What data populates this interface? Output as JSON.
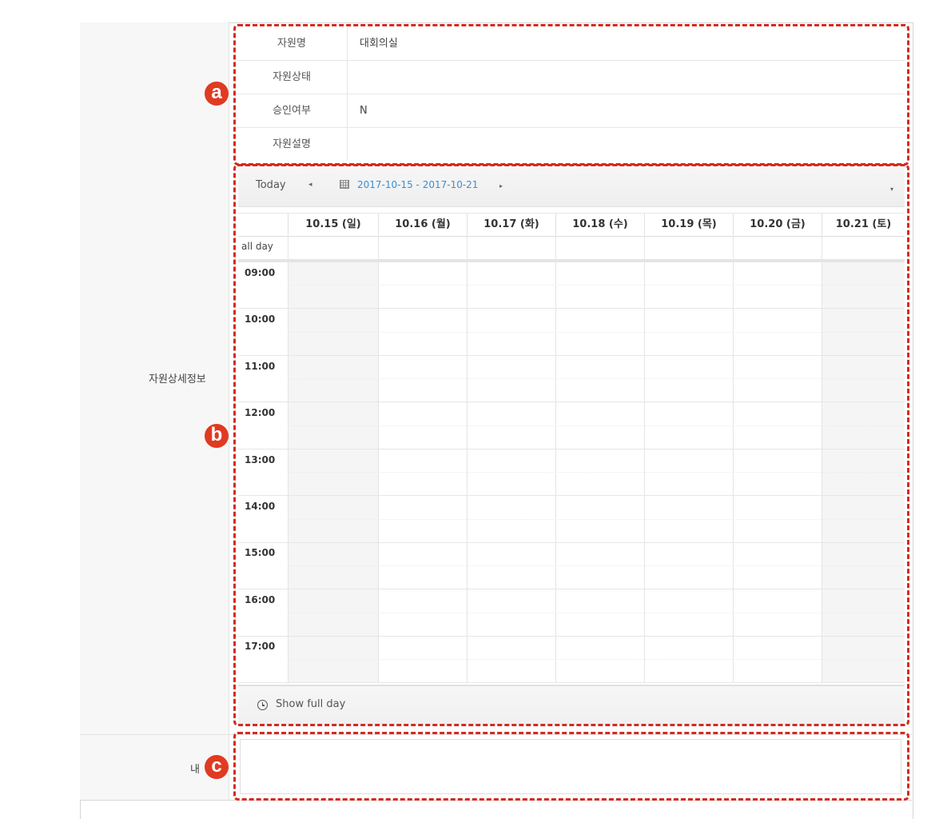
{
  "left_labels": {
    "detail": "자원상세정보",
    "content": "내"
  },
  "info": {
    "rows": [
      {
        "label": "자원명",
        "value": "대회의실"
      },
      {
        "label": "자원상태",
        "value": ""
      },
      {
        "label": "승인여부",
        "value": "N"
      },
      {
        "label": "자원설명",
        "value": ""
      }
    ]
  },
  "calendar": {
    "today_label": "Today",
    "prev_icon": "◂",
    "next_icon": "▸",
    "dropdown_icon": "▾",
    "date_range": "2017-10-15 - 2017-10-21",
    "all_day_label": "all day",
    "days": [
      "10.15 (일)",
      "10.16 (월)",
      "10.17 (화)",
      "10.18 (수)",
      "10.19 (목)",
      "10.20 (금)",
      "10.21 (토)"
    ],
    "times": [
      "09:00",
      "10:00",
      "11:00",
      "12:00",
      "13:00",
      "14:00",
      "15:00",
      "16:00",
      "17:00"
    ],
    "show_full_day": "Show full day"
  },
  "annotations": {
    "a": "a",
    "b": "b",
    "c": "c",
    "color": "#d42a20"
  }
}
